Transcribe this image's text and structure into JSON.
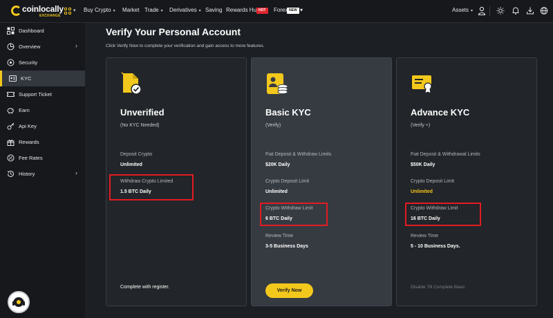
{
  "header": {
    "logo_text": "coinlocally",
    "logo_sub": "EXCHANGE",
    "nav": [
      {
        "label": "Buy Crypto",
        "caret": "▾"
      },
      {
        "label": "Market",
        "caret": ""
      },
      {
        "label": "Trade",
        "caret": "▾"
      },
      {
        "label": "Derivatives",
        "caret": "▾"
      },
      {
        "label": "Saving",
        "caret": ""
      },
      {
        "label": "Rewards Hub",
        "caret": ""
      },
      {
        "label": "Forex",
        "caret": "▾"
      }
    ],
    "hot_badge": "HOT",
    "new_badge": "NEW",
    "assets_label": "Assets",
    "assets_caret": "▾"
  },
  "sidebar": {
    "items": [
      {
        "label": "Dashboard",
        "icon": "dashboard-icon"
      },
      {
        "label": "Overview",
        "icon": "overview-icon",
        "chevron": "›"
      },
      {
        "label": "Security",
        "icon": "security-icon"
      },
      {
        "label": "KYC",
        "icon": "id-card-icon",
        "active": true
      },
      {
        "label": "Support Ticket",
        "icon": "ticket-icon"
      },
      {
        "label": "Earn",
        "icon": "piggy-bank-icon"
      },
      {
        "label": "Api Key",
        "icon": "key-icon"
      },
      {
        "label": "Rewards",
        "icon": "gift-icon"
      },
      {
        "label": "Fee Rates",
        "icon": "percent-icon"
      },
      {
        "label": "History",
        "icon": "history-icon",
        "chevron": "›"
      }
    ]
  },
  "main": {
    "title": "Verify Your Personal Account",
    "subtitle": "Click Verify Now to complete your verification and gain access to more features."
  },
  "cards": [
    {
      "title": "Unverified",
      "subtitle": "(No KYC Needed)",
      "fields": [
        {
          "label": "Deposit Crypto",
          "value": "Unlimited"
        },
        {
          "label": "Withdraw Crypto Limited",
          "value": "1.5 BTC Daily"
        }
      ],
      "footer": "Complete with register."
    },
    {
      "title": "Basic KYC",
      "subtitle": "(Verify)",
      "fields": [
        {
          "label": "Fiat Deposit & Withdraw Limits",
          "value": "$20K Daily"
        },
        {
          "label": "Crypto Deposit Limit",
          "value": "Unlimited"
        },
        {
          "label": "Crypto Withdraw Limit",
          "value": "6 BTC Daily"
        },
        {
          "label": "Review Time",
          "value": "3-5 Business Days"
        }
      ],
      "button": "Verify Now"
    },
    {
      "title": "Advance KYC",
      "subtitle": "(Verify +)",
      "fields": [
        {
          "label": "Fiat Deposit & Withdrawal Limits",
          "value": "$50K Daily"
        },
        {
          "label": "Crypto Deposit Limit",
          "value": "Unlimited"
        },
        {
          "label": "Crypto Withdraw Limit",
          "value": "16 BTC  Daily"
        },
        {
          "label": "Review Time",
          "value": "5 - 10 Business Days."
        }
      ],
      "footer": "Disable Till Complete Basic"
    }
  ],
  "colors": {
    "accent": "#f3c81c",
    "highlight": "#e31b23",
    "page_bg": "#1c1f24",
    "card_bg": "#222529",
    "card_active_bg": "#363b42"
  }
}
